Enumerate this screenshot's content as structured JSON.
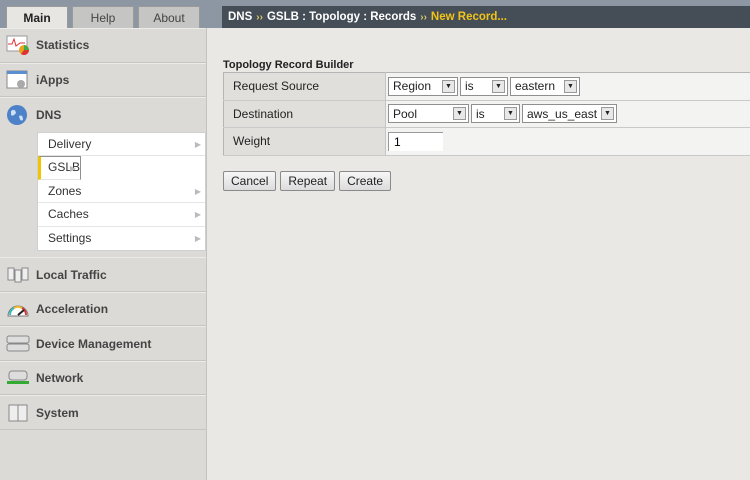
{
  "tabs": [
    "Main",
    "Help",
    "About"
  ],
  "breadcrumb": {
    "parts": [
      "DNS",
      "GSLB : Topology : Records"
    ],
    "current": "New Record...",
    "sep": "››"
  },
  "sidebar": {
    "items_top": [
      {
        "label": "Statistics",
        "icon": "statistics-icon"
      },
      {
        "label": "iApps",
        "icon": "iapps-icon"
      },
      {
        "label": "DNS",
        "icon": "globe-icon"
      }
    ],
    "dns_sub": [
      "Delivery",
      "GSLB",
      "Zones",
      "Caches",
      "Settings"
    ],
    "items_bottom": [
      {
        "label": "Local Traffic",
        "icon": "local-traffic-icon"
      },
      {
        "label": "Acceleration",
        "icon": "gauge-icon"
      },
      {
        "label": "Device Management",
        "icon": "device-icon"
      },
      {
        "label": "Network",
        "icon": "network-icon"
      },
      {
        "label": "System",
        "icon": "system-icon"
      }
    ]
  },
  "form": {
    "title": "Topology Record Builder",
    "rows": [
      {
        "label": "Request Source",
        "type": "Region",
        "op": "is",
        "value": "eastern"
      },
      {
        "label": "Destination",
        "type": "Pool",
        "op": "is",
        "value": "aws_us_east"
      },
      {
        "label": "Weight",
        "value": "1"
      }
    ],
    "buttons": [
      "Cancel",
      "Repeat",
      "Create"
    ]
  }
}
